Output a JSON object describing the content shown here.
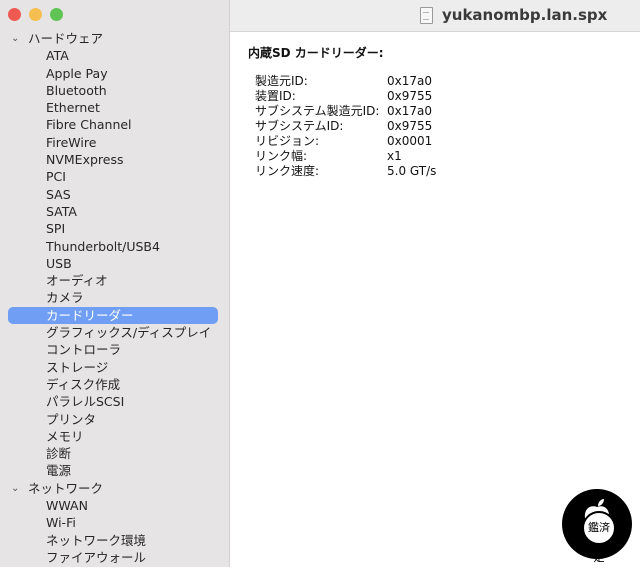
{
  "window": {
    "title": "yukanombp.lan.spx"
  },
  "sidebar": {
    "sections": [
      {
        "label": "ハードウェア",
        "items": [
          "ATA",
          "Apple Pay",
          "Bluetooth",
          "Ethernet",
          "Fibre Channel",
          "FireWire",
          "NVMExpress",
          "PCI",
          "SAS",
          "SATA",
          "SPI",
          "Thunderbolt/USB4",
          "USB",
          "オーディオ",
          "カメラ",
          "カードリーダー",
          "グラフィックス/ディスプレイ",
          "コントローラ",
          "ストレージ",
          "ディスク作成",
          "パラレルSCSI",
          "プリンタ",
          "メモリ",
          "診断",
          "電源"
        ]
      },
      {
        "label": "ネットワーク",
        "items": [
          "WWAN",
          "Wi-Fi",
          "ネットワーク環境",
          "ファイアウォール"
        ]
      }
    ],
    "selected": "カードリーダー"
  },
  "detail": {
    "heading": "内蔵SD カードリーダー:",
    "properties": [
      {
        "key": "製造元ID:",
        "value": "0x17a0"
      },
      {
        "key": "装置ID:",
        "value": "0x9755"
      },
      {
        "key": "サブシステム製造元ID:",
        "value": "0x17a0"
      },
      {
        "key": "サブシステムID:",
        "value": "0x9755"
      },
      {
        "key": "リビジョン:",
        "value": "0x0001"
      },
      {
        "key": "リンク幅:",
        "value": "x1"
      },
      {
        "key": "リンク速度:",
        "value": "5.0 GT/s"
      }
    ]
  },
  "watermark": {
    "text": "鑑済定",
    "icon": "apple-logo-icon"
  }
}
